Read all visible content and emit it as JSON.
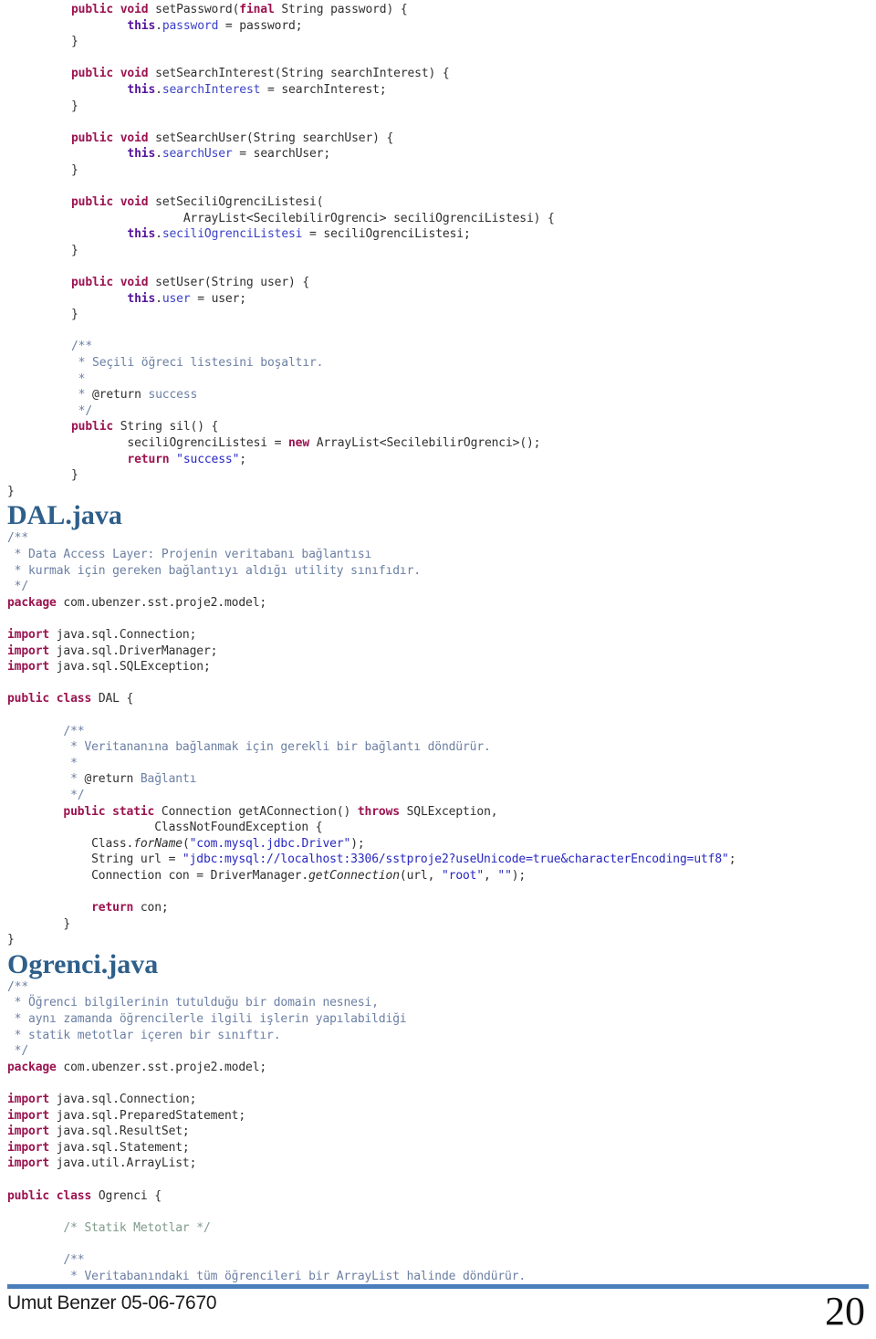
{
  "document": {
    "type": "code-listing-page",
    "page_number": "20",
    "footer_author": "Umut Benzer 05-06-7670",
    "accent_color": "#4a7ebb",
    "heading_color": "#2e5f8a"
  },
  "sections": [
    {
      "id": "setters-tail",
      "heading": null,
      "lines": [
        [
          {
            "t": "public ",
            "c": "kw"
          },
          {
            "t": "void ",
            "c": "kw"
          },
          {
            "t": "setPassword(",
            "c": "pl"
          },
          {
            "t": "final ",
            "c": "kw"
          },
          {
            "t": "String password) {",
            "c": "pl"
          }
        ],
        [
          {
            "t": "        ",
            "c": "pl"
          },
          {
            "t": "this",
            "c": "this"
          },
          {
            "t": ".",
            "c": "pl"
          },
          {
            "t": "password",
            "c": "field"
          },
          {
            "t": " = password;",
            "c": "pl"
          }
        ],
        [
          {
            "t": "}",
            "c": "pl"
          }
        ],
        [
          {
            "t": "",
            "c": "pl"
          }
        ],
        [
          {
            "t": "public ",
            "c": "kw"
          },
          {
            "t": "void ",
            "c": "kw"
          },
          {
            "t": "setSearchInterest(String searchInterest) {",
            "c": "pl"
          }
        ],
        [
          {
            "t": "        ",
            "c": "pl"
          },
          {
            "t": "this",
            "c": "this"
          },
          {
            "t": ".",
            "c": "pl"
          },
          {
            "t": "searchInterest",
            "c": "field"
          },
          {
            "t": " = searchInterest;",
            "c": "pl"
          }
        ],
        [
          {
            "t": "}",
            "c": "pl"
          }
        ],
        [
          {
            "t": "",
            "c": "pl"
          }
        ],
        [
          {
            "t": "public ",
            "c": "kw"
          },
          {
            "t": "void ",
            "c": "kw"
          },
          {
            "t": "setSearchUser(String searchUser) {",
            "c": "pl"
          }
        ],
        [
          {
            "t": "        ",
            "c": "pl"
          },
          {
            "t": "this",
            "c": "this"
          },
          {
            "t": ".",
            "c": "pl"
          },
          {
            "t": "searchUser",
            "c": "field"
          },
          {
            "t": " = searchUser;",
            "c": "pl"
          }
        ],
        [
          {
            "t": "}",
            "c": "pl"
          }
        ],
        [
          {
            "t": "",
            "c": "pl"
          }
        ],
        [
          {
            "t": "public ",
            "c": "kw"
          },
          {
            "t": "void ",
            "c": "kw"
          },
          {
            "t": "setSeciliOgrenciListesi(",
            "c": "pl"
          }
        ],
        [
          {
            "t": "                ArrayList<SecilebilirOgrenci> seciliOgrenciListesi) {",
            "c": "pl"
          }
        ],
        [
          {
            "t": "        ",
            "c": "pl"
          },
          {
            "t": "this",
            "c": "this"
          },
          {
            "t": ".",
            "c": "pl"
          },
          {
            "t": "seciliOgrenciListesi",
            "c": "field"
          },
          {
            "t": " = seciliOgrenciListesi;",
            "c": "pl"
          }
        ],
        [
          {
            "t": "}",
            "c": "pl"
          }
        ],
        [
          {
            "t": "",
            "c": "pl"
          }
        ],
        [
          {
            "t": "public ",
            "c": "kw"
          },
          {
            "t": "void ",
            "c": "kw"
          },
          {
            "t": "setUser(String user) {",
            "c": "pl"
          }
        ],
        [
          {
            "t": "        ",
            "c": "pl"
          },
          {
            "t": "this",
            "c": "this"
          },
          {
            "t": ".",
            "c": "pl"
          },
          {
            "t": "user",
            "c": "field"
          },
          {
            "t": " = user;",
            "c": "pl"
          }
        ],
        [
          {
            "t": "}",
            "c": "pl"
          }
        ],
        [
          {
            "t": "",
            "c": "pl"
          }
        ],
        [
          {
            "t": "/**",
            "c": "cmt"
          }
        ],
        [
          {
            "t": " * Seçili öğreci listesini boşaltır.",
            "c": "cmt"
          }
        ],
        [
          {
            "t": " *",
            "c": "cmt"
          }
        ],
        [
          {
            "t": " * ",
            "c": "cmt"
          },
          {
            "t": "@return",
            "c": "tag"
          },
          {
            "t": " success",
            "c": "cmt"
          }
        ],
        [
          {
            "t": " */",
            "c": "cmt"
          }
        ],
        [
          {
            "t": "public ",
            "c": "kw"
          },
          {
            "t": "String sil() {",
            "c": "pl"
          }
        ],
        [
          {
            "t": "        seciliOgrenciListesi = ",
            "c": "pl"
          },
          {
            "t": "new ",
            "c": "kw"
          },
          {
            "t": "ArrayList<SecilebilirOgrenci>();",
            "c": "pl"
          }
        ],
        [
          {
            "t": "        ",
            "c": "pl"
          },
          {
            "t": "return ",
            "c": "kw"
          },
          {
            "t": "\"success\"",
            "c": "str"
          },
          {
            "t": ";",
            "c": "pl"
          }
        ],
        [
          {
            "t": "}",
            "c": "pl"
          }
        ]
      ],
      "outdent_lines": [
        [
          {
            "t": "}",
            "c": "pl"
          }
        ]
      ]
    },
    {
      "id": "dal-java",
      "heading": "DAL.java",
      "lines": [
        [
          {
            "t": "/**",
            "c": "cmt"
          }
        ],
        [
          {
            "t": " * Data Access Layer: Projenin veritabanı bağlantısı",
            "c": "cmt"
          }
        ],
        [
          {
            "t": " * kurmak için gereken bağlantıyı aldığı utility sınıfıdır.",
            "c": "cmt"
          }
        ],
        [
          {
            "t": " */",
            "c": "cmt"
          }
        ],
        [
          {
            "t": "package ",
            "c": "kw"
          },
          {
            "t": "com.ubenzer.sst.proje2.model;",
            "c": "pl"
          }
        ],
        [
          {
            "t": "",
            "c": "pl"
          }
        ],
        [
          {
            "t": "import ",
            "c": "kw"
          },
          {
            "t": "java.sql.Connection;",
            "c": "pl"
          }
        ],
        [
          {
            "t": "import ",
            "c": "kw"
          },
          {
            "t": "java.sql.DriverManager;",
            "c": "pl"
          }
        ],
        [
          {
            "t": "import ",
            "c": "kw"
          },
          {
            "t": "java.sql.SQLException;",
            "c": "pl"
          }
        ],
        [
          {
            "t": "",
            "c": "pl"
          }
        ],
        [
          {
            "t": "public ",
            "c": "kw"
          },
          {
            "t": "class ",
            "c": "kw"
          },
          {
            "t": "DAL {",
            "c": "pl"
          }
        ],
        [
          {
            "t": "",
            "c": "pl"
          }
        ],
        [
          {
            "t": "        /**",
            "c": "cmt"
          }
        ],
        [
          {
            "t": "         * Veritananına bağlanmak için gerekli bir bağlantı döndürür.",
            "c": "cmt"
          }
        ],
        [
          {
            "t": "         *",
            "c": "cmt"
          }
        ],
        [
          {
            "t": "         * ",
            "c": "cmt"
          },
          {
            "t": "@return",
            "c": "tag"
          },
          {
            "t": " Bağlantı",
            "c": "cmt"
          }
        ],
        [
          {
            "t": "         */",
            "c": "cmt"
          }
        ],
        [
          {
            "t": "        ",
            "c": "pl"
          },
          {
            "t": "public ",
            "c": "kw"
          },
          {
            "t": "static ",
            "c": "kw"
          },
          {
            "t": "Connection getAConnection() ",
            "c": "pl"
          },
          {
            "t": "throws ",
            "c": "kw"
          },
          {
            "t": "SQLException,",
            "c": "pl"
          }
        ],
        [
          {
            "t": "                     ClassNotFoundException {",
            "c": "pl"
          }
        ],
        [
          {
            "t": "            Class.",
            "c": "pl"
          },
          {
            "t": "forName",
            "c": "ital"
          },
          {
            "t": "(",
            "c": "pl"
          },
          {
            "t": "\"com.mysql.jdbc.Driver\"",
            "c": "str"
          },
          {
            "t": ");",
            "c": "pl"
          }
        ],
        [
          {
            "t": "            String url = ",
            "c": "pl"
          },
          {
            "t": "\"jdbc:mysql://localhost:3306/sstproje2?useUnicode=true&characterEncoding=utf8\"",
            "c": "str"
          },
          {
            "t": ";",
            "c": "pl"
          }
        ],
        [
          {
            "t": "            Connection con = DriverManager.",
            "c": "pl"
          },
          {
            "t": "getConnection",
            "c": "ital"
          },
          {
            "t": "(url, ",
            "c": "pl"
          },
          {
            "t": "\"root\"",
            "c": "str"
          },
          {
            "t": ", ",
            "c": "pl"
          },
          {
            "t": "\"\"",
            "c": "str"
          },
          {
            "t": ");",
            "c": "pl"
          }
        ],
        [
          {
            "t": "",
            "c": "pl"
          }
        ],
        [
          {
            "t": "            ",
            "c": "pl"
          },
          {
            "t": "return ",
            "c": "kw"
          },
          {
            "t": "con;",
            "c": "pl"
          }
        ],
        [
          {
            "t": "        }",
            "c": "pl"
          }
        ]
      ],
      "outdent_lines": [
        [
          {
            "t": "}",
            "c": "pl"
          }
        ]
      ]
    },
    {
      "id": "ogrenci-java",
      "heading": "Ogrenci.java",
      "lines": [
        [
          {
            "t": "/**",
            "c": "cmt"
          }
        ],
        [
          {
            "t": " * Öğrenci bilgilerinin tutulduğu bir domain nesnesi,",
            "c": "cmt"
          }
        ],
        [
          {
            "t": " * aynı zamanda öğrencilerle ilgili işlerin yapılabildiği",
            "c": "cmt"
          }
        ],
        [
          {
            "t": " * statik metotlar içeren bir sınıftır.",
            "c": "cmt"
          }
        ],
        [
          {
            "t": " */",
            "c": "cmt"
          }
        ],
        [
          {
            "t": "package ",
            "c": "kw"
          },
          {
            "t": "com.ubenzer.sst.proje2.model;",
            "c": "pl"
          }
        ],
        [
          {
            "t": "",
            "c": "pl"
          }
        ],
        [
          {
            "t": "import ",
            "c": "kw"
          },
          {
            "t": "java.sql.Connection;",
            "c": "pl"
          }
        ],
        [
          {
            "t": "import ",
            "c": "kw"
          },
          {
            "t": "java.sql.PreparedStatement;",
            "c": "pl"
          }
        ],
        [
          {
            "t": "import ",
            "c": "kw"
          },
          {
            "t": "java.sql.ResultSet;",
            "c": "pl"
          }
        ],
        [
          {
            "t": "import ",
            "c": "kw"
          },
          {
            "t": "java.sql.Statement;",
            "c": "pl"
          }
        ],
        [
          {
            "t": "import ",
            "c": "kw"
          },
          {
            "t": "java.util.ArrayList;",
            "c": "pl"
          }
        ],
        [
          {
            "t": "",
            "c": "pl"
          }
        ],
        [
          {
            "t": "public ",
            "c": "kw"
          },
          {
            "t": "class ",
            "c": "kw"
          },
          {
            "t": "Ogrenci {",
            "c": "pl"
          }
        ],
        [
          {
            "t": "",
            "c": "pl"
          }
        ],
        [
          {
            "t": "        /* Statik Metotlar */",
            "c": "cmt2"
          }
        ],
        [
          {
            "t": "",
            "c": "pl"
          }
        ],
        [
          {
            "t": "        /**",
            "c": "cmt"
          }
        ],
        [
          {
            "t": "         * Veritabanındaki tüm öğrencileri bir ArrayList halinde döndürür.",
            "c": "cmt"
          }
        ]
      ],
      "outdent_lines": []
    }
  ]
}
